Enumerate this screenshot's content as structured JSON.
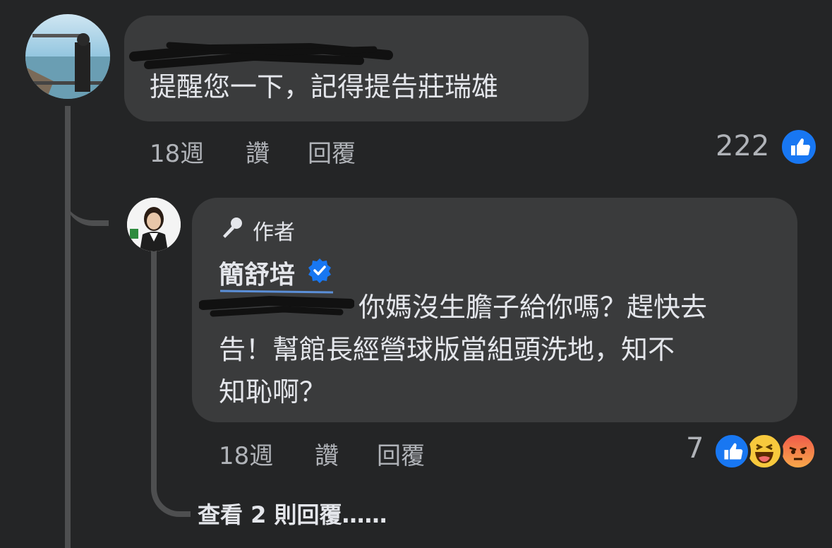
{
  "comment1": {
    "text": "提醒您一下，記得提告莊瑞雄",
    "time": "18週",
    "like_label": "讚",
    "reply_label": "回覆",
    "reaction_count": "222",
    "reactions": [
      "like-icon"
    ]
  },
  "reply1": {
    "author_badge": "作者",
    "author_name": "簡舒培",
    "verified": true,
    "text_line1": "你媽沒生膽子給你嗎？趕快去",
    "text_line2": "告！幫館長經營球版當組頭洗地，知不",
    "text_line3": "知恥啊？",
    "time": "18週",
    "like_label": "讚",
    "reply_label": "回覆",
    "reaction_count": "7",
    "reactions": [
      "like-icon",
      "haha-icon",
      "angry-icon"
    ]
  },
  "view_more_replies": "查看 2 則回覆……",
  "colors": {
    "background": "#242526",
    "bubble": "#3a3b3c",
    "text": "#e4e6eb",
    "secondary_text": "#b0b3b8",
    "like_blue": "#1877f2",
    "verified_blue": "#1877f2"
  }
}
